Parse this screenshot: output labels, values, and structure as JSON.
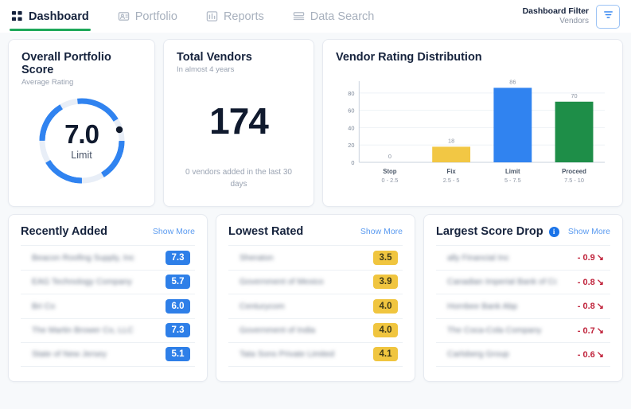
{
  "nav": {
    "items": [
      {
        "label": "Dashboard",
        "icon": "grid-icon",
        "active": true
      },
      {
        "label": "Portfolio",
        "icon": "portfolio-icon",
        "active": false
      },
      {
        "label": "Reports",
        "icon": "bar-chart-icon",
        "active": false
      },
      {
        "label": "Data Search",
        "icon": "data-search-icon",
        "active": false
      }
    ]
  },
  "filter": {
    "title": "Dashboard Filter",
    "value": "Vendors",
    "icon": "funnel-icon"
  },
  "score_card": {
    "title": "Overall Portfolio Score",
    "subtitle": "Average Rating",
    "value": "7.0",
    "label": "Limit",
    "percent": 70,
    "arc_color": "#3083f0",
    "track_color": "#e8eef7"
  },
  "vendors_card": {
    "title": "Total Vendors",
    "subtitle": "In almost 4 years",
    "value": "174",
    "footnote": "0 vendors added in the last 30 days"
  },
  "chart_data": {
    "type": "bar",
    "title": "Vendor Rating Distribution",
    "categories": [
      "Stop",
      "Fix",
      "Limit",
      "Proceed"
    ],
    "category_ranges": [
      "0 - 2.5",
      "2.5 - 5",
      "5 - 7.5",
      "7.5 - 10"
    ],
    "values": [
      0,
      18,
      86,
      70
    ],
    "colors": [
      "#f2c744",
      "#f2c744",
      "#3083f0",
      "#1e8e48"
    ],
    "xlabel": "",
    "ylabel": "",
    "ylim": [
      0,
      90
    ],
    "yticks": [
      0,
      20,
      40,
      60,
      80
    ],
    "grid": true,
    "legend": false,
    "data_labels": [
      "0",
      "18",
      "86",
      "70"
    ]
  },
  "recently_added": {
    "title": "Recently Added",
    "show_more": "Show More",
    "rows": [
      {
        "name": "Beacon Roofing Supply, Inc",
        "score": "7.3"
      },
      {
        "name": "EAG Technology Company",
        "score": "5.7"
      },
      {
        "name": "Bri Co",
        "score": "6.0"
      },
      {
        "name": "The Martin Brower Co, LLC",
        "score": "7.3"
      },
      {
        "name": "State of New Jersey",
        "score": "5.1"
      }
    ]
  },
  "lowest_rated": {
    "title": "Lowest Rated",
    "show_more": "Show More",
    "rows": [
      {
        "name": "Sheraton",
        "score": "3.5"
      },
      {
        "name": "Government of Mexico",
        "score": "3.9"
      },
      {
        "name": "Centurycom",
        "score": "4.0"
      },
      {
        "name": "Government of India",
        "score": "4.0"
      },
      {
        "name": "Tata Sons Private Limited",
        "score": "4.1"
      }
    ]
  },
  "largest_score_drop": {
    "title": "Largest Score Drop",
    "info_icon": "info-icon",
    "show_more": "Show More",
    "rows": [
      {
        "name": "ally Financial Inc",
        "delta": "- 0.9",
        "arrow": "↘"
      },
      {
        "name": "Canadian Imperial Bank of Commerce",
        "delta": "- 0.8",
        "arrow": "↘"
      },
      {
        "name": "Hornbee Bank Abp",
        "delta": "- 0.8",
        "arrow": "↘"
      },
      {
        "name": "The Coca-Cola Company",
        "delta": "- 0.7",
        "arrow": "↘"
      },
      {
        "name": "Carlsberg Group",
        "delta": "- 0.6",
        "arrow": "↘"
      }
    ]
  }
}
